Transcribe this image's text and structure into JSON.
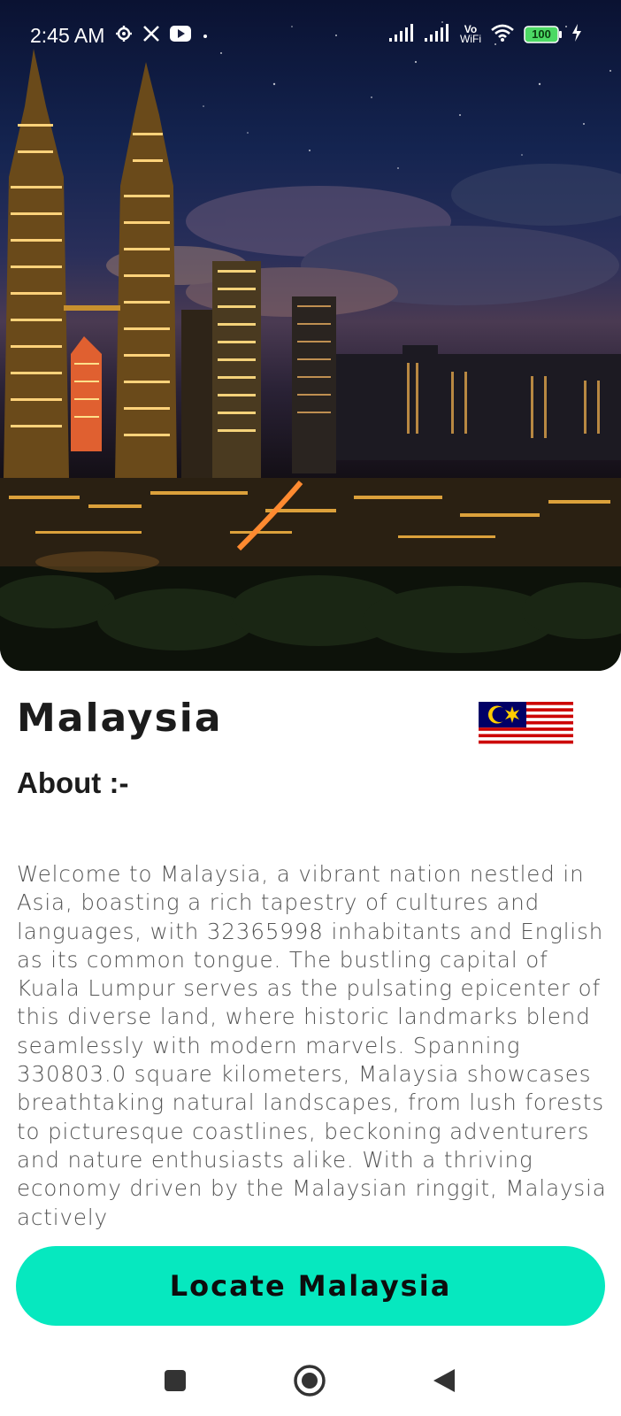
{
  "status_bar": {
    "time": "2:45 AM",
    "left_icons": [
      "settings-icon",
      "x-logo-icon",
      "youtube-icon",
      "dot-icon"
    ],
    "right_icons": [
      "signal-icon",
      "signal-icon",
      "vowifi-icon",
      "wifi-icon",
      "battery-icon",
      "charging-icon"
    ],
    "vowifi_top": "Vo",
    "vowifi_bottom": "WiFi",
    "battery": "100"
  },
  "hero": {
    "image": "kuala-lumpur-night-skyline"
  },
  "country": {
    "name": "Malaysia",
    "flag": "malaysia-flag-icon"
  },
  "about": {
    "title": "About :-",
    "description": "Welcome to Malaysia, a vibrant nation nestled in Asia, boasting a rich tapestry of cultures and languages, with 32365998 inhabitants and English as its common tongue. The bustling capital of Kuala Lumpur serves as the pulsating epicenter of this diverse land, where historic landmarks blend seamlessly with modern marvels. Spanning 330803.0 square kilometers, Malaysia showcases breathtaking natural landscapes, from lush forests to picturesque coastlines, beckoning adventurers and nature enthusiasts alike. With a thriving economy driven by the Malaysian ringgit, Malaysia actively"
  },
  "actions": {
    "locate_label": "Locate Malaysia"
  },
  "colors": {
    "accent": "#06e8bf",
    "text": "#1c1c1c",
    "body_text": "#555555"
  },
  "nav_bar": {
    "buttons": [
      "recents-icon",
      "home-icon",
      "back-icon"
    ]
  }
}
